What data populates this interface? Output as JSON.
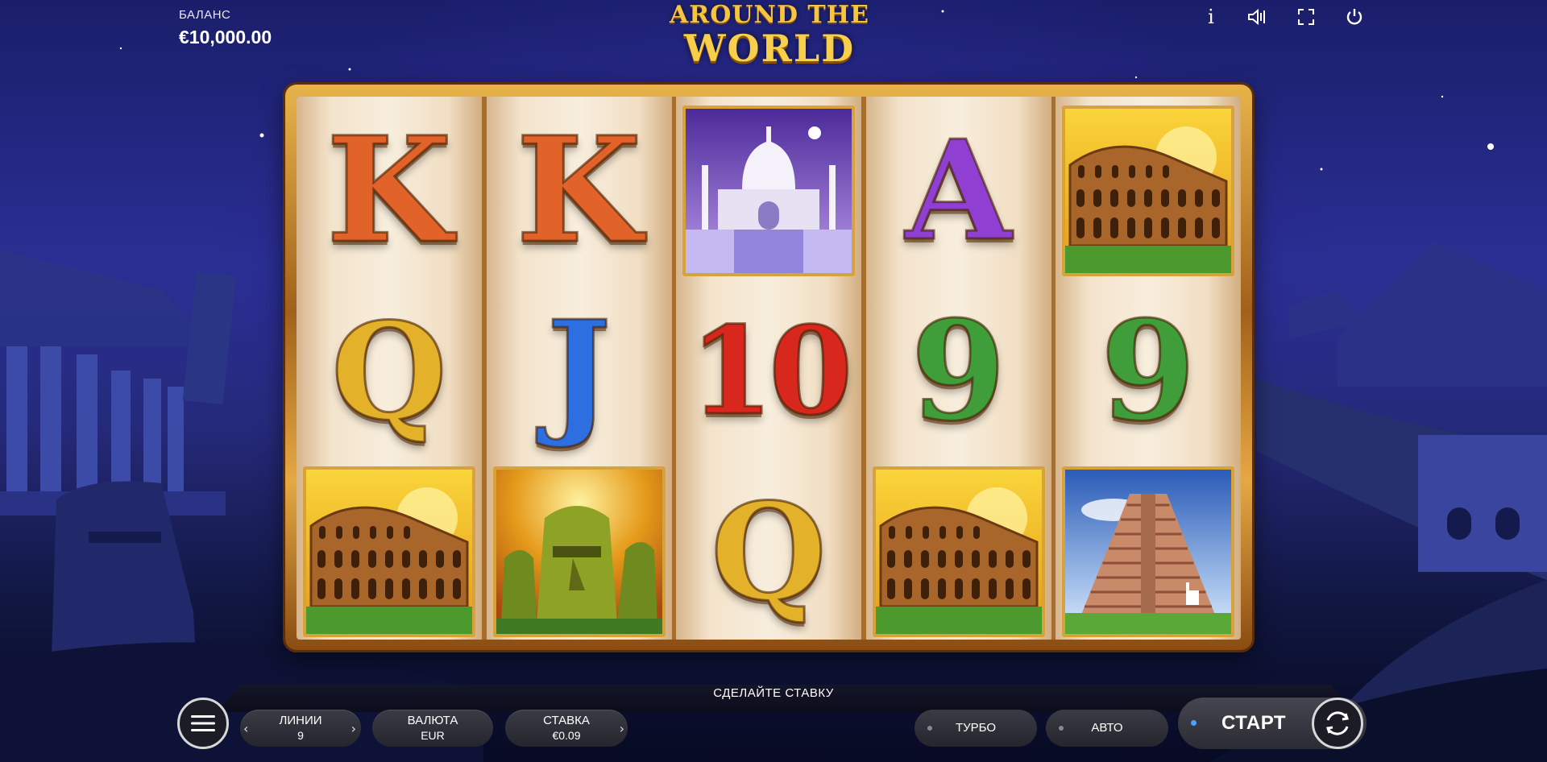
{
  "balance": {
    "label": "БАЛАНС",
    "value": "€10,000.00"
  },
  "logo": {
    "line1": "AROUND THE",
    "line2": "WORLD"
  },
  "top_icons": [
    "info-icon",
    "sound-icon",
    "fullscreen-icon",
    "power-icon"
  ],
  "top_icon_glyphs": {
    "info": "i"
  },
  "reels": [
    [
      "K",
      "Q",
      "colosseum"
    ],
    [
      "K",
      "J",
      "moai"
    ],
    [
      "taj-mahal",
      "10",
      "Q"
    ],
    [
      "A",
      "9",
      "colosseum"
    ],
    [
      "colosseum",
      "9",
      "pyramid"
    ]
  ],
  "symbols": {
    "K": "K",
    "Q": "Q",
    "J": "J",
    "A": "A",
    "10": "10",
    "9": "9"
  },
  "panel": {
    "message": "СДЕЛАЙТЕ СТАВКУ",
    "lines": {
      "label": "ЛИНИИ",
      "value": "9"
    },
    "currency": {
      "label": "ВАЛЮТА",
      "value": "EUR"
    },
    "bet": {
      "label": "СТАВКА",
      "value": "€0.09"
    },
    "turbo": "ТУРБО",
    "auto": "АВТО",
    "start": "СТАРТ",
    "prev_glyph": "‹",
    "next_glyph": "›"
  },
  "colors": {
    "accent_blue": "#4aa3ff",
    "frame_gold": "#e5a843",
    "sky": "#2b2f94"
  }
}
